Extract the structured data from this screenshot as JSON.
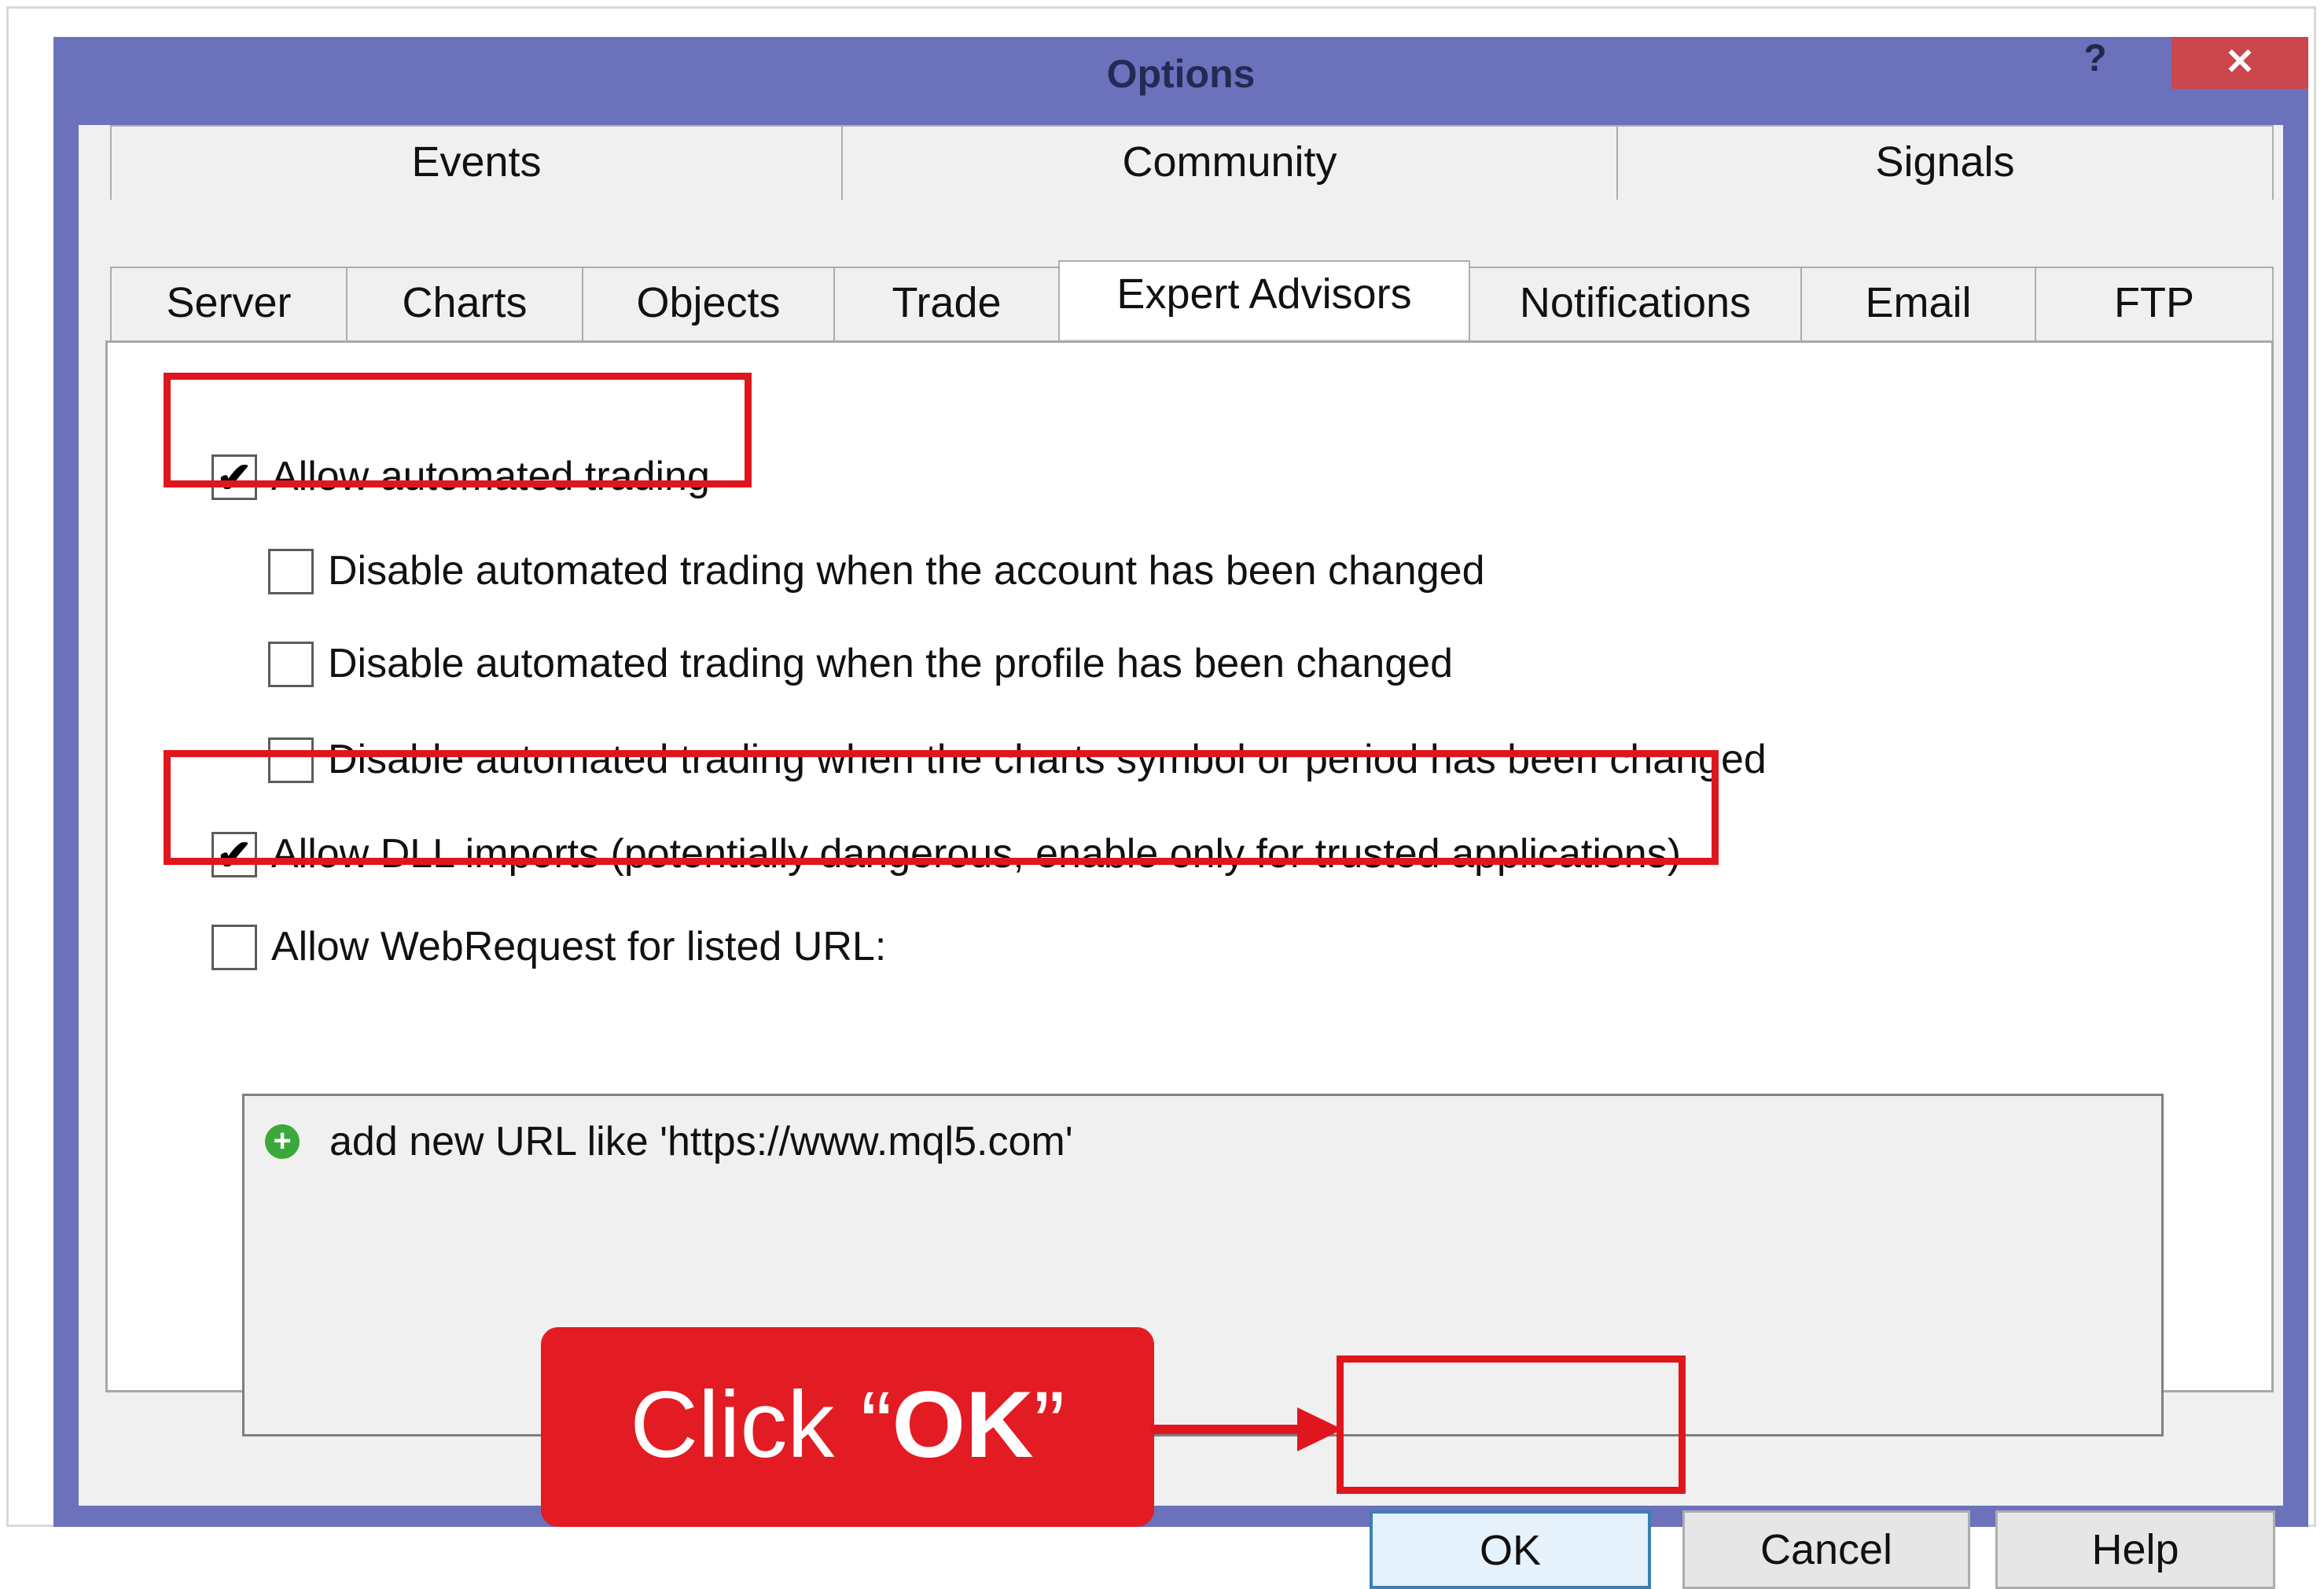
{
  "window": {
    "title": "Options",
    "help_label": "?",
    "close_label": "✕"
  },
  "tabs": {
    "row1": [
      "Events",
      "Community",
      "Signals"
    ],
    "row2": [
      "Server",
      "Charts",
      "Objects",
      "Trade",
      "Expert Advisors",
      "Notifications",
      "Email",
      "FTP"
    ],
    "active": "Expert Advisors"
  },
  "options": {
    "allow_automated": {
      "label": "Allow automated trading",
      "checked": true
    },
    "disable_account": {
      "label": "Disable automated trading when the account has been changed",
      "checked": false
    },
    "disable_profile": {
      "label": "Disable automated trading when the profile has been changed",
      "checked": false
    },
    "disable_symbol": {
      "label": "Disable automated trading when the charts symbol or period has been changed",
      "checked": false
    },
    "allow_dll": {
      "label": "Allow DLL imports (potentially dangerous, enable only for trusted applications)",
      "checked": true
    },
    "allow_webrequest": {
      "label": "Allow WebRequest for listed URL:",
      "checked": false
    }
  },
  "url_list": {
    "add_text": "add new URL like 'https://www.mql5.com'",
    "add_icon": "plus-circle-icon"
  },
  "buttons": {
    "ok": "OK",
    "cancel": "Cancel",
    "help": "Help"
  },
  "annotation": {
    "callout_prefix": "Click “",
    "callout_bold": "OK",
    "callout_suffix": "”",
    "color": "#e31b23"
  }
}
